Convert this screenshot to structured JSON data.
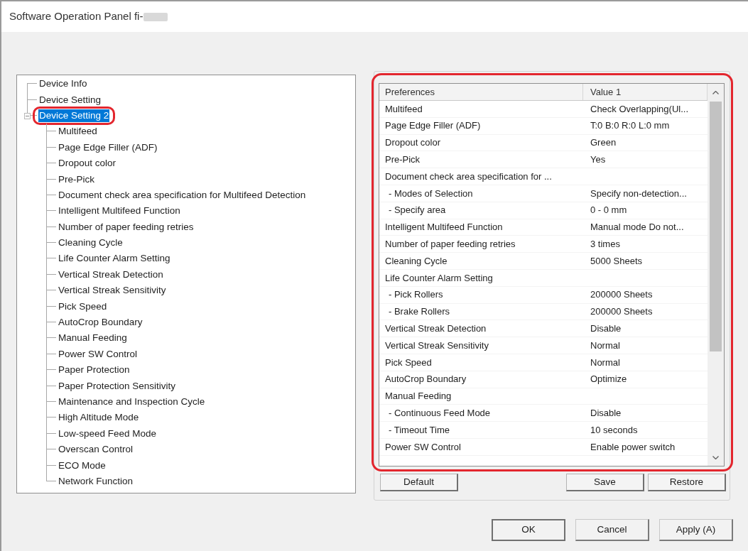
{
  "window": {
    "title": "Software Operation Panel fi-",
    "redacted_suffix": true
  },
  "tree": {
    "items": [
      {
        "label": "Device Info",
        "selected": false,
        "highlighted": false
      },
      {
        "label": "Device Setting",
        "selected": false,
        "highlighted": false
      },
      {
        "label": "Device Setting 2",
        "selected": true,
        "highlighted": true,
        "expanded": true,
        "children": [
          {
            "label": "Multifeed",
            "selected": false,
            "highlighted": false
          },
          {
            "label": "Page Edge Filler (ADF)",
            "selected": false,
            "highlighted": false
          },
          {
            "label": "Dropout color",
            "selected": false,
            "highlighted": false
          },
          {
            "label": "Pre-Pick",
            "selected": false,
            "highlighted": false
          },
          {
            "label": "Document check area specification for Multifeed Detection",
            "selected": false,
            "highlighted": false
          },
          {
            "label": "Intelligent Multifeed Function",
            "selected": false,
            "highlighted": false
          },
          {
            "label": "Number of paper feeding retries",
            "selected": false,
            "highlighted": false
          },
          {
            "label": "Cleaning Cycle",
            "selected": false,
            "highlighted": false
          },
          {
            "label": "Life Counter Alarm Setting",
            "selected": false,
            "highlighted": false
          },
          {
            "label": "Vertical Streak Detection",
            "selected": false,
            "highlighted": false
          },
          {
            "label": "Vertical Streak Sensitivity",
            "selected": false,
            "highlighted": false
          },
          {
            "label": "Pick Speed",
            "selected": false,
            "highlighted": false
          },
          {
            "label": "AutoCrop Boundary",
            "selected": false,
            "highlighted": false
          },
          {
            "label": "Manual Feeding",
            "selected": false,
            "highlighted": false
          },
          {
            "label": "Power SW Control",
            "selected": false,
            "highlighted": false
          },
          {
            "label": "Paper Protection",
            "selected": false,
            "highlighted": false
          },
          {
            "label": "Paper Protection Sensitivity",
            "selected": false,
            "highlighted": false
          },
          {
            "label": "Maintenance and Inspection Cycle",
            "selected": false,
            "highlighted": false
          },
          {
            "label": "High Altitude Mode",
            "selected": false,
            "highlighted": false
          },
          {
            "label": "Low-speed Feed Mode",
            "selected": false,
            "highlighted": false
          },
          {
            "label": "Overscan Control",
            "selected": false,
            "highlighted": false
          },
          {
            "label": "ECO Mode",
            "selected": false,
            "highlighted": false
          },
          {
            "label": "Network Function",
            "selected": false,
            "highlighted": false
          }
        ]
      }
    ]
  },
  "preferences": {
    "highlighted": true,
    "columns": [
      "Preferences",
      "Value 1"
    ],
    "rows": [
      {
        "preference": "Multifeed",
        "value": "Check Overlapping(Ul..."
      },
      {
        "preference": "Page Edge Filler (ADF)",
        "value": "T:0 B:0 R:0 L:0 mm"
      },
      {
        "preference": "Dropout color",
        "value": "Green"
      },
      {
        "preference": "Pre-Pick",
        "value": "Yes"
      },
      {
        "preference": "Document check area specification for ...",
        "children": [
          {
            "preference": "- Modes of Selection",
            "value": "Specify non-detection..."
          },
          {
            "preference": "- Specify area",
            "value": "0 - 0 mm"
          }
        ]
      },
      {
        "preference": "Intelligent Multifeed Function",
        "value": "Manual mode Do not..."
      },
      {
        "preference": "Number of paper feeding retries",
        "value": "3 times"
      },
      {
        "preference": "Cleaning Cycle",
        "value": "5000 Sheets"
      },
      {
        "preference": "Life Counter Alarm Setting",
        "children": [
          {
            "preference": "- Pick Rollers",
            "value": "200000 Sheets"
          },
          {
            "preference": "- Brake Rollers",
            "value": "200000 Sheets"
          }
        ]
      },
      {
        "preference": "Vertical Streak Detection",
        "value": "Disable"
      },
      {
        "preference": "Vertical Streak Sensitivity",
        "value": "Normal"
      },
      {
        "preference": "Pick Speed",
        "value": "Normal"
      },
      {
        "preference": "AutoCrop Boundary",
        "value": "Optimize"
      },
      {
        "preference": "Manual Feeding",
        "children": [
          {
            "preference": "- Continuous Feed Mode",
            "value": "Disable"
          },
          {
            "preference": "- Timeout Time",
            "value": "10 seconds"
          }
        ]
      },
      {
        "preference": "Power SW Control",
        "value": "Enable power switch"
      }
    ]
  },
  "panel_buttons": {
    "left": [
      "Default"
    ],
    "right": [
      "Save",
      "Restore"
    ]
  },
  "dialog_buttons": [
    {
      "label": "OK",
      "default": true
    },
    {
      "label": "Cancel",
      "default": false
    },
    {
      "label": "Apply (A)",
      "default": false
    }
  ]
}
